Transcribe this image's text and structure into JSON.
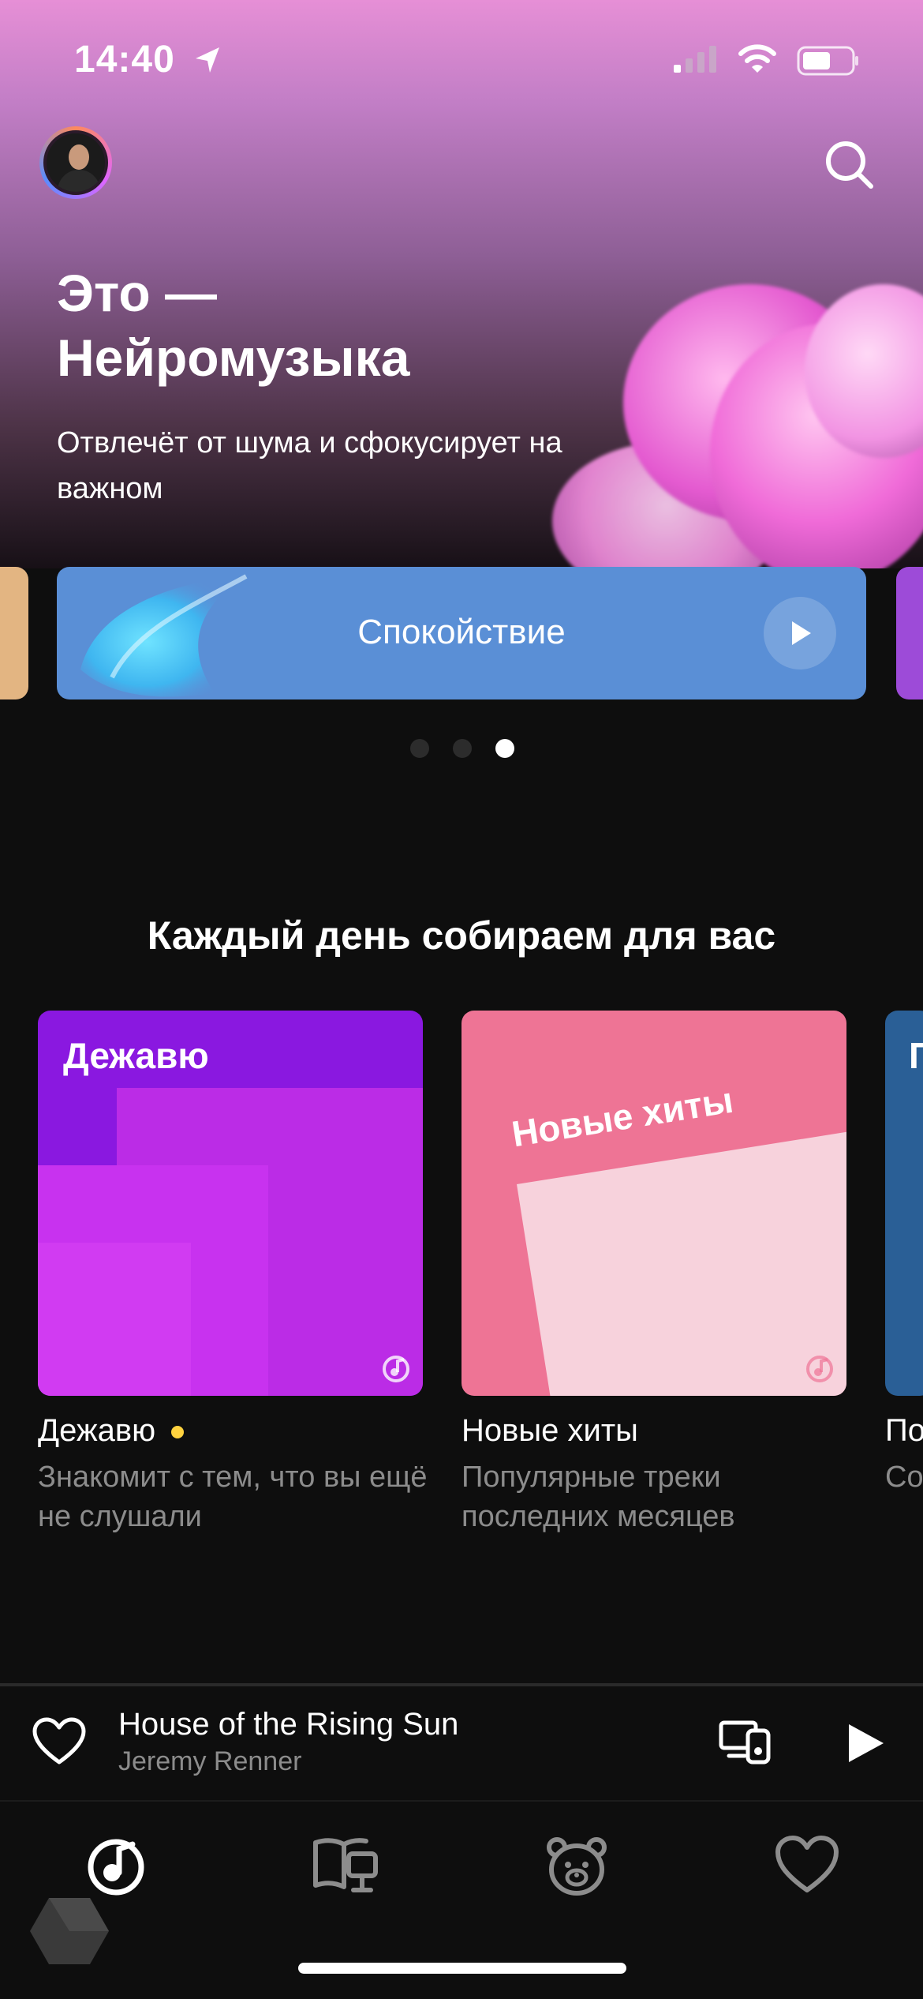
{
  "status_bar": {
    "time": "14:40"
  },
  "hero": {
    "title_line1": "Это —",
    "title_line2": "Нейромузыка",
    "subtitle": "Отвлечёт от шума и сфокусирует на важном"
  },
  "mood_card": {
    "label": "Спокойствие"
  },
  "carousel": {
    "page_count": 3,
    "active_index": 2
  },
  "section": {
    "title": "Каждый день собираем для вас"
  },
  "playlists": [
    {
      "cover_title": "Дежавю",
      "name": "Дежавю",
      "description": "Знакомит с тем, что вы ещё не слушали",
      "color": "#8a18e0",
      "new_indicator": true
    },
    {
      "cover_title": "Новые хиты",
      "name": "Новые хиты",
      "description": "Популярные треки последних месяцев",
      "color": "#ee7495"
    },
    {
      "cover_title": "П",
      "name": "По",
      "description": "Со",
      "color": "#2a5f96"
    }
  ],
  "mini_player": {
    "song": "House of the Rising Sun",
    "artist": "Jeremy Renner"
  },
  "tabs": [
    {
      "icon": "music-note-disc-icon",
      "active": true
    },
    {
      "icon": "library-book-icon"
    },
    {
      "icon": "bear-kids-icon"
    },
    {
      "icon": "heart-icon"
    }
  ],
  "colors": {
    "background": "#0e0e0e",
    "accent_blue": "#5a8fd6",
    "yellow_indicator": "#ffd23f"
  }
}
